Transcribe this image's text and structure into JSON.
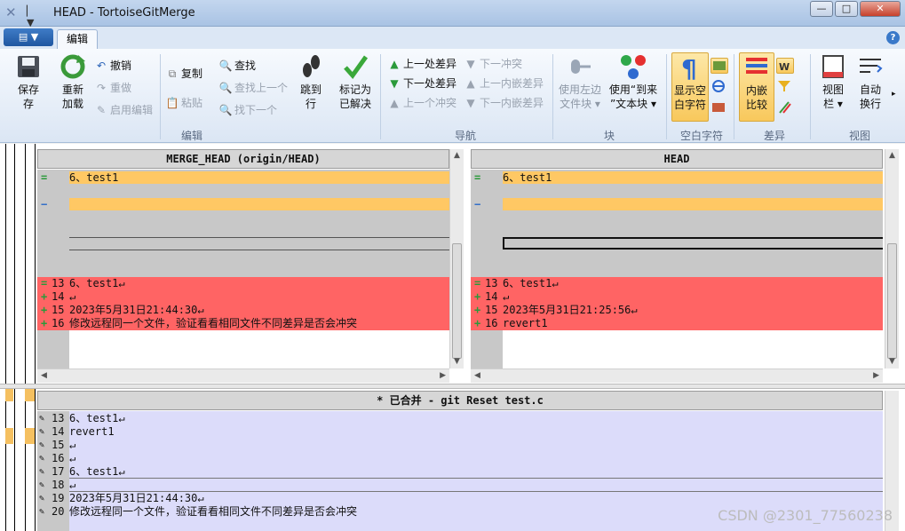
{
  "window": {
    "title": "HEAD - TortoiseGitMerge",
    "qat_label": "▏ ▼",
    "min": "—",
    "max": "□",
    "close": "✕"
  },
  "ribbon": {
    "file_button": "▤ ▼",
    "tab_edit": "编辑",
    "help": "?",
    "groups": {
      "edit": "编辑",
      "nav": "导航",
      "block": "块",
      "whitespace": "空白字符",
      "diff": "差异",
      "view": "视图"
    },
    "save": "保存",
    "reload_1": "重新",
    "reload_2": "加载",
    "undo": "撤销",
    "redo": "重做",
    "enable_edit": "启用编辑",
    "copy": "复制",
    "paste": "粘贴",
    "find": "查找",
    "find_prev": "查找上一个",
    "find_next": "找下一个",
    "goto_1": "跳到",
    "goto_2": "行",
    "mark_1": "标记为",
    "mark_2": "已解决",
    "prev_diff": "上一处差异",
    "next_diff": "下一处差异",
    "prev_conflict": "上一个冲突",
    "next_conflict": "下一冲突",
    "prev_inline": "上一内嵌差异",
    "next_inline": "下一内嵌差异",
    "use_left_1": "使用左边",
    "use_left_2": "文件块 ▾",
    "use_to_1": "使用“到来",
    "use_to_2": "”文本块 ▾",
    "show_ws_1": "显示空",
    "show_ws_2": "白字符",
    "inline_1": "内嵌",
    "inline_2": "比较",
    "view_bar_1": "视图",
    "view_bar_2": "栏 ▾",
    "autowrap_1": "自动",
    "autowrap_2": "换行"
  },
  "left_pane": {
    "header": "MERGE_HEAD (origin/HEAD)",
    "lines": [
      {
        "mark": "=",
        "num": "",
        "text": "6、test1"
      },
      {
        "mark": "−",
        "num": "",
        "text": ""
      },
      {
        "mark": "=",
        "num": "13",
        "text": "6、test1↵"
      },
      {
        "mark": "+",
        "num": "14",
        "text": "↵"
      },
      {
        "mark": "+",
        "num": "15",
        "text": "2023年5月31日21:44:30↵"
      },
      {
        "mark": "+",
        "num": "16",
        "text": "修改远程同一个文件，验证看看相同文件不同差异是否会冲突"
      }
    ]
  },
  "right_pane": {
    "header": "HEAD",
    "lines": [
      {
        "mark": "=",
        "num": "",
        "text": "6、test1"
      },
      {
        "mark": "−",
        "num": "",
        "text": ""
      },
      {
        "mark": "=",
        "num": "13",
        "text": "6、test1↵"
      },
      {
        "mark": "+",
        "num": "14",
        "text": "↵"
      },
      {
        "mark": "+",
        "num": "15",
        "text": "2023年5月31日21:25:56↵"
      },
      {
        "mark": "+",
        "num": "16",
        "text": "revert1"
      }
    ]
  },
  "bottom_pane": {
    "header": "* 已合并 - git Reset test.c",
    "lines": [
      {
        "num": "13",
        "text": "6、test1↵"
      },
      {
        "num": "14",
        "text": "revert1"
      },
      {
        "num": "15",
        "text": "↵"
      },
      {
        "num": "16",
        "text": "↵"
      },
      {
        "num": "17",
        "text": "6、test1↵"
      },
      {
        "num": "18",
        "text": "↵"
      },
      {
        "num": "19",
        "text": "2023年5月31日21:44:30↵"
      },
      {
        "num": "20",
        "text": "修改远程同一个文件，验证看看相同文件不同差异是否会冲突"
      }
    ]
  },
  "watermark": "CSDN @2301_77560238",
  "colors": {
    "orange_line": "#ffc864",
    "red_block": "#ff6464",
    "gray_bg": "#c8c8c8",
    "merged_bg": "#dcdcfa"
  }
}
